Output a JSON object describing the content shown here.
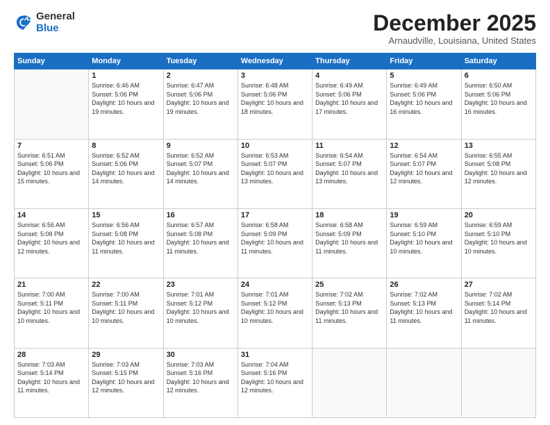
{
  "logo": {
    "general": "General",
    "blue": "Blue"
  },
  "title": "December 2025",
  "subtitle": "Arnaudville, Louisiana, United States",
  "days": [
    "Sunday",
    "Monday",
    "Tuesday",
    "Wednesday",
    "Thursday",
    "Friday",
    "Saturday"
  ],
  "weeks": [
    [
      {
        "day": "",
        "sunrise": "",
        "sunset": "",
        "daylight": ""
      },
      {
        "day": "1",
        "sunrise": "Sunrise: 6:46 AM",
        "sunset": "Sunset: 5:06 PM",
        "daylight": "Daylight: 10 hours and 19 minutes."
      },
      {
        "day": "2",
        "sunrise": "Sunrise: 6:47 AM",
        "sunset": "Sunset: 5:06 PM",
        "daylight": "Daylight: 10 hours and 19 minutes."
      },
      {
        "day": "3",
        "sunrise": "Sunrise: 6:48 AM",
        "sunset": "Sunset: 5:06 PM",
        "daylight": "Daylight: 10 hours and 18 minutes."
      },
      {
        "day": "4",
        "sunrise": "Sunrise: 6:49 AM",
        "sunset": "Sunset: 5:06 PM",
        "daylight": "Daylight: 10 hours and 17 minutes."
      },
      {
        "day": "5",
        "sunrise": "Sunrise: 6:49 AM",
        "sunset": "Sunset: 5:06 PM",
        "daylight": "Daylight: 10 hours and 16 minutes."
      },
      {
        "day": "6",
        "sunrise": "Sunrise: 6:50 AM",
        "sunset": "Sunset: 5:06 PM",
        "daylight": "Daylight: 10 hours and 16 minutes."
      }
    ],
    [
      {
        "day": "7",
        "sunrise": "Sunrise: 6:51 AM",
        "sunset": "Sunset: 5:06 PM",
        "daylight": "Daylight: 10 hours and 15 minutes."
      },
      {
        "day": "8",
        "sunrise": "Sunrise: 6:52 AM",
        "sunset": "Sunset: 5:06 PM",
        "daylight": "Daylight: 10 hours and 14 minutes."
      },
      {
        "day": "9",
        "sunrise": "Sunrise: 6:52 AM",
        "sunset": "Sunset: 5:07 PM",
        "daylight": "Daylight: 10 hours and 14 minutes."
      },
      {
        "day": "10",
        "sunrise": "Sunrise: 6:53 AM",
        "sunset": "Sunset: 5:07 PM",
        "daylight": "Daylight: 10 hours and 13 minutes."
      },
      {
        "day": "11",
        "sunrise": "Sunrise: 6:54 AM",
        "sunset": "Sunset: 5:07 PM",
        "daylight": "Daylight: 10 hours and 13 minutes."
      },
      {
        "day": "12",
        "sunrise": "Sunrise: 6:54 AM",
        "sunset": "Sunset: 5:07 PM",
        "daylight": "Daylight: 10 hours and 12 minutes."
      },
      {
        "day": "13",
        "sunrise": "Sunrise: 6:55 AM",
        "sunset": "Sunset: 5:08 PM",
        "daylight": "Daylight: 10 hours and 12 minutes."
      }
    ],
    [
      {
        "day": "14",
        "sunrise": "Sunrise: 6:56 AM",
        "sunset": "Sunset: 5:08 PM",
        "daylight": "Daylight: 10 hours and 12 minutes."
      },
      {
        "day": "15",
        "sunrise": "Sunrise: 6:56 AM",
        "sunset": "Sunset: 5:08 PM",
        "daylight": "Daylight: 10 hours and 11 minutes."
      },
      {
        "day": "16",
        "sunrise": "Sunrise: 6:57 AM",
        "sunset": "Sunset: 5:08 PM",
        "daylight": "Daylight: 10 hours and 11 minutes."
      },
      {
        "day": "17",
        "sunrise": "Sunrise: 6:58 AM",
        "sunset": "Sunset: 5:09 PM",
        "daylight": "Daylight: 10 hours and 11 minutes."
      },
      {
        "day": "18",
        "sunrise": "Sunrise: 6:58 AM",
        "sunset": "Sunset: 5:09 PM",
        "daylight": "Daylight: 10 hours and 11 minutes."
      },
      {
        "day": "19",
        "sunrise": "Sunrise: 6:59 AM",
        "sunset": "Sunset: 5:10 PM",
        "daylight": "Daylight: 10 hours and 10 minutes."
      },
      {
        "day": "20",
        "sunrise": "Sunrise: 6:59 AM",
        "sunset": "Sunset: 5:10 PM",
        "daylight": "Daylight: 10 hours and 10 minutes."
      }
    ],
    [
      {
        "day": "21",
        "sunrise": "Sunrise: 7:00 AM",
        "sunset": "Sunset: 5:11 PM",
        "daylight": "Daylight: 10 hours and 10 minutes."
      },
      {
        "day": "22",
        "sunrise": "Sunrise: 7:00 AM",
        "sunset": "Sunset: 5:11 PM",
        "daylight": "Daylight: 10 hours and 10 minutes."
      },
      {
        "day": "23",
        "sunrise": "Sunrise: 7:01 AM",
        "sunset": "Sunset: 5:12 PM",
        "daylight": "Daylight: 10 hours and 10 minutes."
      },
      {
        "day": "24",
        "sunrise": "Sunrise: 7:01 AM",
        "sunset": "Sunset: 5:12 PM",
        "daylight": "Daylight: 10 hours and 10 minutes."
      },
      {
        "day": "25",
        "sunrise": "Sunrise: 7:02 AM",
        "sunset": "Sunset: 5:13 PM",
        "daylight": "Daylight: 10 hours and 11 minutes."
      },
      {
        "day": "26",
        "sunrise": "Sunrise: 7:02 AM",
        "sunset": "Sunset: 5:13 PM",
        "daylight": "Daylight: 10 hours and 11 minutes."
      },
      {
        "day": "27",
        "sunrise": "Sunrise: 7:02 AM",
        "sunset": "Sunset: 5:14 PM",
        "daylight": "Daylight: 10 hours and 11 minutes."
      }
    ],
    [
      {
        "day": "28",
        "sunrise": "Sunrise: 7:03 AM",
        "sunset": "Sunset: 5:14 PM",
        "daylight": "Daylight: 10 hours and 11 minutes."
      },
      {
        "day": "29",
        "sunrise": "Sunrise: 7:03 AM",
        "sunset": "Sunset: 5:15 PM",
        "daylight": "Daylight: 10 hours and 12 minutes."
      },
      {
        "day": "30",
        "sunrise": "Sunrise: 7:03 AM",
        "sunset": "Sunset: 5:16 PM",
        "daylight": "Daylight: 10 hours and 12 minutes."
      },
      {
        "day": "31",
        "sunrise": "Sunrise: 7:04 AM",
        "sunset": "Sunset: 5:16 PM",
        "daylight": "Daylight: 10 hours and 12 minutes."
      },
      {
        "day": "",
        "sunrise": "",
        "sunset": "",
        "daylight": ""
      },
      {
        "day": "",
        "sunrise": "",
        "sunset": "",
        "daylight": ""
      },
      {
        "day": "",
        "sunrise": "",
        "sunset": "",
        "daylight": ""
      }
    ]
  ]
}
